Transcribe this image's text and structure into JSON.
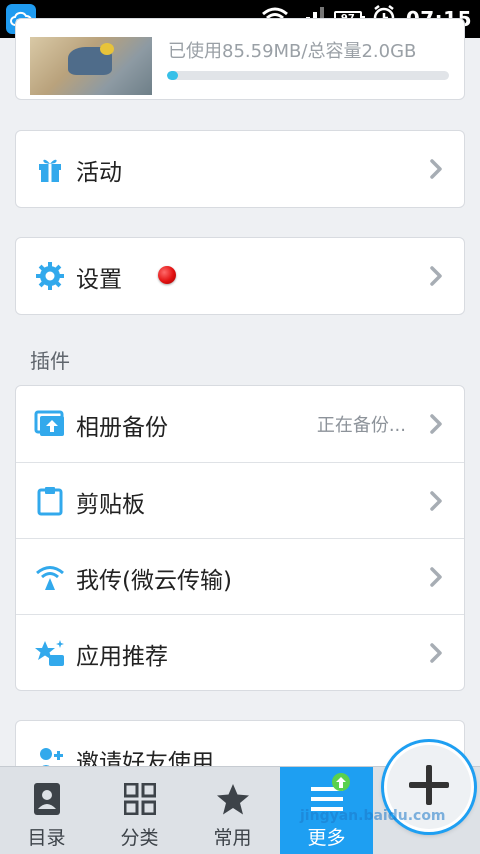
{
  "status_bar": {
    "battery": "97",
    "time": "07:15",
    "icons": [
      "cloud-app-icon",
      "wifi-icon",
      "signal-icon",
      "battery-icon",
      "alarm-icon"
    ]
  },
  "storage": {
    "text": "已使用85.59MB/总容量2.0GB",
    "used_fraction": 0.04
  },
  "rows": {
    "activity": {
      "label": "活动",
      "icon": "gift-icon"
    },
    "settings": {
      "label": "设置",
      "icon": "gear-icon"
    },
    "album_backup": {
      "label": "相册备份",
      "status": "正在备份...",
      "icon": "album-upload-icon"
    },
    "clipboard": {
      "label": "剪贴板",
      "icon": "clipboard-icon"
    },
    "transfer": {
      "label": "我传(微云传输)",
      "icon": "wireless-transfer-icon"
    },
    "recommend": {
      "label": "应用推荐",
      "icon": "star-sparkle-icon"
    },
    "invite": {
      "label": "邀请好友使用",
      "icon": "invite-friends-icon"
    }
  },
  "section": {
    "plugins": "插件"
  },
  "tabs": [
    {
      "label": "目录",
      "icon": "contacts-book-icon"
    },
    {
      "label": "分类",
      "icon": "grid-icon"
    },
    {
      "label": "常用",
      "icon": "star-icon"
    },
    {
      "label": "更多",
      "icon": "menu-icon"
    }
  ],
  "fab": {
    "icon": "plus-icon"
  },
  "watermark": "jingyan.baidu.com",
  "colors": {
    "accent": "#1e9ff2",
    "progress": "#37c0e8",
    "badge": "#5ad04d",
    "alert": "#e21111"
  }
}
